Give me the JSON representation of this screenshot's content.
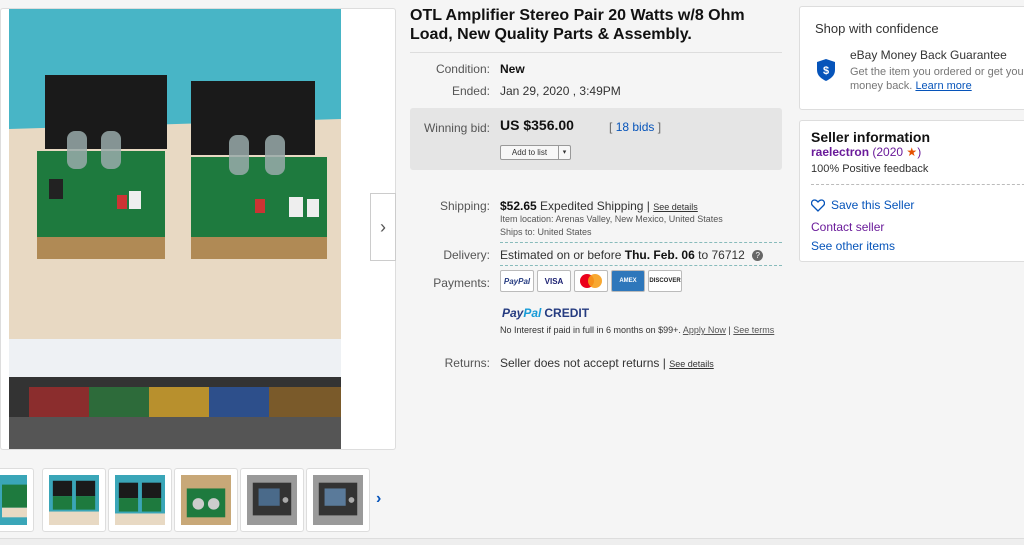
{
  "listing": {
    "title": "OTL Amplifier Stereo Pair 20 Watts w/8 Ohm Load, New Quality Parts & Assembly."
  },
  "details": {
    "condition_label": "Condition:",
    "condition_value": "New",
    "ended_label": "Ended:",
    "ended_value": "Jan 29, 2020 , 3:49PM",
    "winning_bid_label": "Winning bid:",
    "winning_bid_value": "US $356.00",
    "bids_open": "[",
    "bids_link": "18 bids",
    "bids_close": "]",
    "add_to_list": "Add to list",
    "add_to_list_dropdown": "▾"
  },
  "shipping": {
    "label": "Shipping:",
    "price": "$52.65",
    "method": "Expedited Shipping |",
    "details_link": "See details",
    "item_location": "Item location:  Arenas Valley, New Mexico, United States",
    "ships_to": "Ships to:  United States"
  },
  "delivery": {
    "label": "Delivery:",
    "text_prefix": "Estimated on or before",
    "date": "Thu. Feb. 06",
    "text_mid": "to",
    "zip": "76712",
    "help": "?"
  },
  "payments": {
    "label": "Payments:",
    "methods": [
      "PayPal",
      "VISA",
      "MasterCard",
      "AMEX",
      "DISCOVER"
    ],
    "credit_brand_1": "Pay",
    "credit_brand_2": "Pal",
    "credit_word": "CREDIT",
    "credit_text": "No Interest if paid in full in 6 months on $99+.",
    "apply_now": "Apply Now",
    "separator": "|",
    "see_terms": "See terms"
  },
  "returns": {
    "label": "Returns:",
    "value": "Seller does not accept returns |",
    "details_link": "See details"
  },
  "shop_confidence": {
    "heading": "Shop with confidence",
    "guarantee_title": "eBay Money Back Guarantee",
    "guarantee_desc": "Get the item you ordered or get your money back.",
    "learn_more": "Learn more"
  },
  "seller": {
    "heading": "Seller information",
    "name": "raelectron",
    "score": "(2020",
    "score_close": ")",
    "star": "★",
    "feedback": "100% Positive feedback",
    "save_seller": "Save this Seller",
    "contact": "Contact seller",
    "other_items": "See other items"
  },
  "gallery": {
    "next_arrow": "›",
    "thumbs_next": "›"
  },
  "colors": {
    "link": "#0654ba",
    "seller_purple": "#6a1b9a",
    "star_orange": "#e65100",
    "bid_box": "#e5e5e5"
  },
  "icons": [
    "shield-icon",
    "heart-icon",
    "chevron-right-icon",
    "help-icon"
  ]
}
